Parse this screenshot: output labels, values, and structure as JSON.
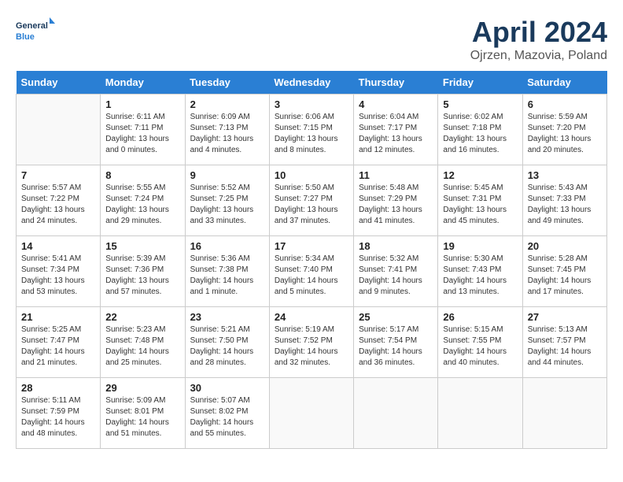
{
  "logo": {
    "general": "General",
    "blue": "Blue"
  },
  "title": "April 2024",
  "location": "Ojrzen, Mazovia, Poland",
  "weekdays": [
    "Sunday",
    "Monday",
    "Tuesday",
    "Wednesday",
    "Thursday",
    "Friday",
    "Saturday"
  ],
  "weeks": [
    [
      {
        "day": "",
        "info": ""
      },
      {
        "day": "1",
        "info": "Sunrise: 6:11 AM\nSunset: 7:11 PM\nDaylight: 13 hours\nand 0 minutes."
      },
      {
        "day": "2",
        "info": "Sunrise: 6:09 AM\nSunset: 7:13 PM\nDaylight: 13 hours\nand 4 minutes."
      },
      {
        "day": "3",
        "info": "Sunrise: 6:06 AM\nSunset: 7:15 PM\nDaylight: 13 hours\nand 8 minutes."
      },
      {
        "day": "4",
        "info": "Sunrise: 6:04 AM\nSunset: 7:17 PM\nDaylight: 13 hours\nand 12 minutes."
      },
      {
        "day": "5",
        "info": "Sunrise: 6:02 AM\nSunset: 7:18 PM\nDaylight: 13 hours\nand 16 minutes."
      },
      {
        "day": "6",
        "info": "Sunrise: 5:59 AM\nSunset: 7:20 PM\nDaylight: 13 hours\nand 20 minutes."
      }
    ],
    [
      {
        "day": "7",
        "info": "Sunrise: 5:57 AM\nSunset: 7:22 PM\nDaylight: 13 hours\nand 24 minutes."
      },
      {
        "day": "8",
        "info": "Sunrise: 5:55 AM\nSunset: 7:24 PM\nDaylight: 13 hours\nand 29 minutes."
      },
      {
        "day": "9",
        "info": "Sunrise: 5:52 AM\nSunset: 7:25 PM\nDaylight: 13 hours\nand 33 minutes."
      },
      {
        "day": "10",
        "info": "Sunrise: 5:50 AM\nSunset: 7:27 PM\nDaylight: 13 hours\nand 37 minutes."
      },
      {
        "day": "11",
        "info": "Sunrise: 5:48 AM\nSunset: 7:29 PM\nDaylight: 13 hours\nand 41 minutes."
      },
      {
        "day": "12",
        "info": "Sunrise: 5:45 AM\nSunset: 7:31 PM\nDaylight: 13 hours\nand 45 minutes."
      },
      {
        "day": "13",
        "info": "Sunrise: 5:43 AM\nSunset: 7:33 PM\nDaylight: 13 hours\nand 49 minutes."
      }
    ],
    [
      {
        "day": "14",
        "info": "Sunrise: 5:41 AM\nSunset: 7:34 PM\nDaylight: 13 hours\nand 53 minutes."
      },
      {
        "day": "15",
        "info": "Sunrise: 5:39 AM\nSunset: 7:36 PM\nDaylight: 13 hours\nand 57 minutes."
      },
      {
        "day": "16",
        "info": "Sunrise: 5:36 AM\nSunset: 7:38 PM\nDaylight: 14 hours\nand 1 minute."
      },
      {
        "day": "17",
        "info": "Sunrise: 5:34 AM\nSunset: 7:40 PM\nDaylight: 14 hours\nand 5 minutes."
      },
      {
        "day": "18",
        "info": "Sunrise: 5:32 AM\nSunset: 7:41 PM\nDaylight: 14 hours\nand 9 minutes."
      },
      {
        "day": "19",
        "info": "Sunrise: 5:30 AM\nSunset: 7:43 PM\nDaylight: 14 hours\nand 13 minutes."
      },
      {
        "day": "20",
        "info": "Sunrise: 5:28 AM\nSunset: 7:45 PM\nDaylight: 14 hours\nand 17 minutes."
      }
    ],
    [
      {
        "day": "21",
        "info": "Sunrise: 5:25 AM\nSunset: 7:47 PM\nDaylight: 14 hours\nand 21 minutes."
      },
      {
        "day": "22",
        "info": "Sunrise: 5:23 AM\nSunset: 7:48 PM\nDaylight: 14 hours\nand 25 minutes."
      },
      {
        "day": "23",
        "info": "Sunrise: 5:21 AM\nSunset: 7:50 PM\nDaylight: 14 hours\nand 28 minutes."
      },
      {
        "day": "24",
        "info": "Sunrise: 5:19 AM\nSunset: 7:52 PM\nDaylight: 14 hours\nand 32 minutes."
      },
      {
        "day": "25",
        "info": "Sunrise: 5:17 AM\nSunset: 7:54 PM\nDaylight: 14 hours\nand 36 minutes."
      },
      {
        "day": "26",
        "info": "Sunrise: 5:15 AM\nSunset: 7:55 PM\nDaylight: 14 hours\nand 40 minutes."
      },
      {
        "day": "27",
        "info": "Sunrise: 5:13 AM\nSunset: 7:57 PM\nDaylight: 14 hours\nand 44 minutes."
      }
    ],
    [
      {
        "day": "28",
        "info": "Sunrise: 5:11 AM\nSunset: 7:59 PM\nDaylight: 14 hours\nand 48 minutes."
      },
      {
        "day": "29",
        "info": "Sunrise: 5:09 AM\nSunset: 8:01 PM\nDaylight: 14 hours\nand 51 minutes."
      },
      {
        "day": "30",
        "info": "Sunrise: 5:07 AM\nSunset: 8:02 PM\nDaylight: 14 hours\nand 55 minutes."
      },
      {
        "day": "",
        "info": ""
      },
      {
        "day": "",
        "info": ""
      },
      {
        "day": "",
        "info": ""
      },
      {
        "day": "",
        "info": ""
      }
    ]
  ]
}
